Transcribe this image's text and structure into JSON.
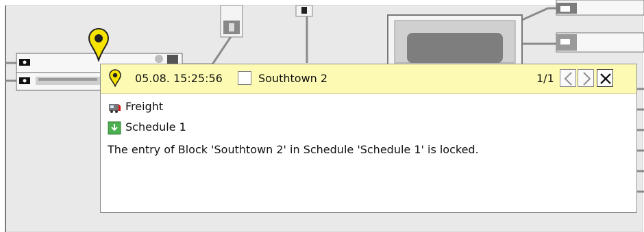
{
  "popup": {
    "timestamp": "05.08. 15:25:56",
    "block": "Southtown 2",
    "counter": "1/1",
    "train": "Freight",
    "schedule": "Schedule 1",
    "message": "The entry of Block 'Southtown 2' in Schedule 'Schedule 1' is locked."
  },
  "icons": {
    "pin": "map-pin-icon",
    "prev": "chevron-left-icon",
    "next": "chevron-right-icon",
    "close": "close-icon",
    "train": "train-icon",
    "schedule": "arrow-down-icon",
    "signal": "signal-icon"
  },
  "colors": {
    "popup_header_bg": "#fdfbb3",
    "board_bg": "#e9e9e9",
    "pin_yellow": "#f6e400",
    "schedule_green": "#4caf50"
  }
}
